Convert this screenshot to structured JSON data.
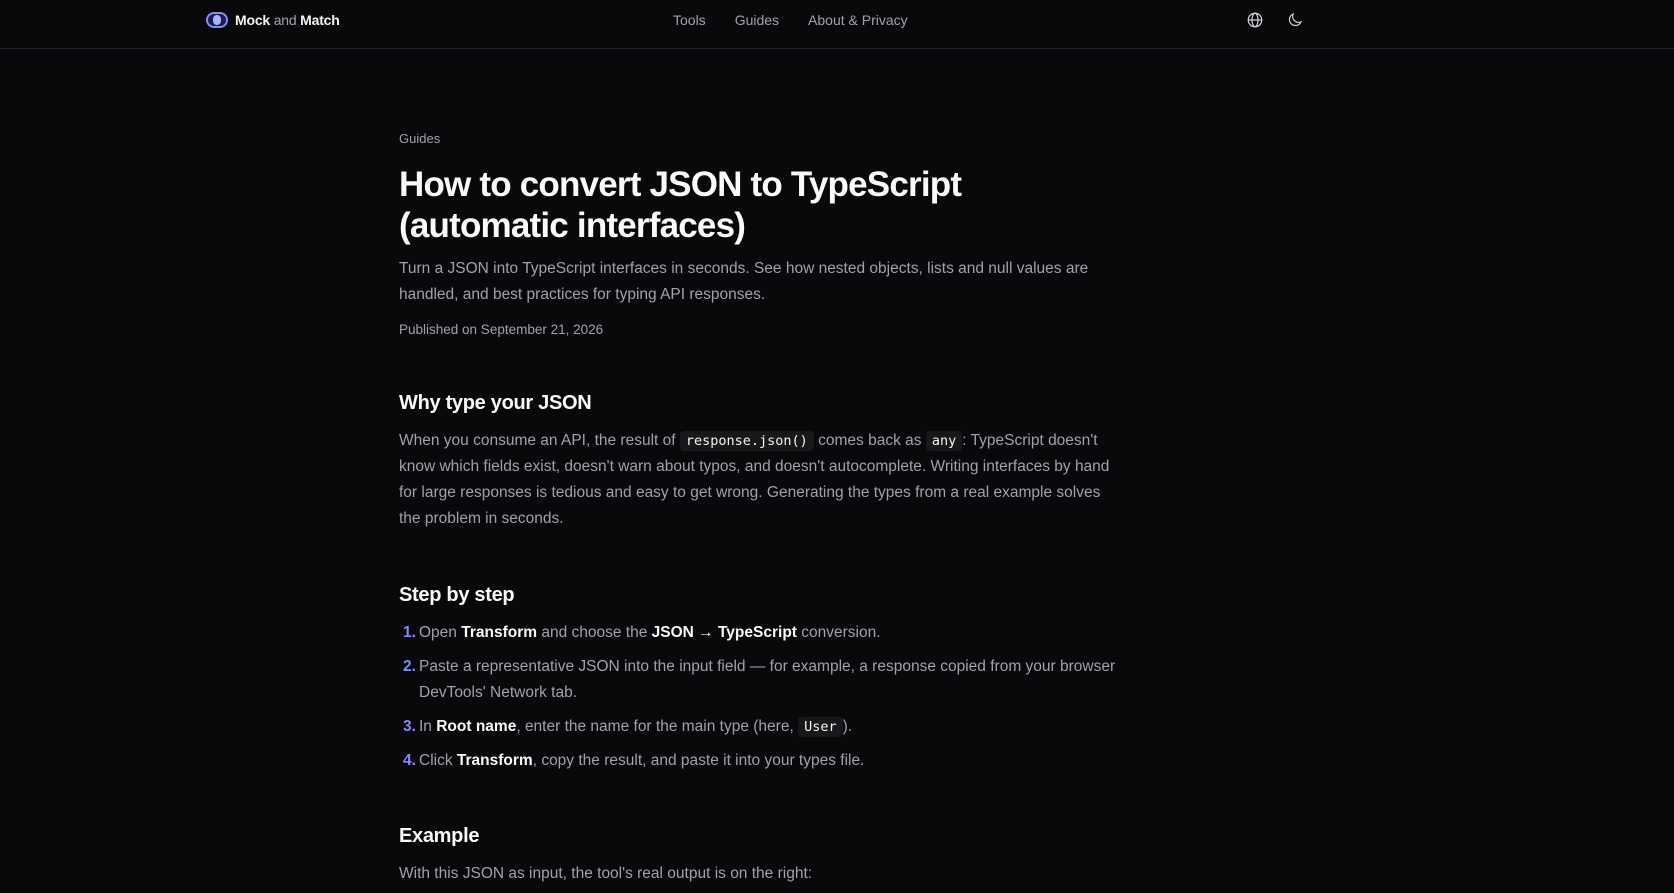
{
  "header": {
    "brand": {
      "part1": "Mock",
      "part2": "and",
      "part3": "Match"
    },
    "nav": [
      "Tools",
      "Guides",
      "About & Privacy"
    ],
    "icons": {
      "language": "globe-icon",
      "theme": "moon-icon"
    }
  },
  "article": {
    "eyebrow": "Guides",
    "title": "How to convert JSON to TypeScript (automatic interfaces)",
    "lead": "Turn a JSON into TypeScript interfaces in seconds. See how nested objects, lists and null values are handled, and best practices for typing API responses.",
    "published": "Published on September 21, 2026",
    "why": {
      "heading": "Why type your JSON",
      "t1": "When you consume an API, the result of ",
      "code1": "response.json()",
      "t2": " comes back as ",
      "code2": "any",
      "t3": ": TypeScript doesn't know which fields exist, doesn't warn about typos, and doesn't autocomplete. Writing interfaces by hand for large responses is tedious and easy to get wrong. Generating the types from a real example solves the problem in seconds."
    },
    "steps": {
      "heading": "Step by step",
      "items": [
        {
          "num": "1.",
          "a": "Open ",
          "b": "Transform",
          "c": " and choose the ",
          "d": "JSON → TypeScript",
          "e": " conversion."
        },
        {
          "num": "2.",
          "text": "Paste a representative JSON into the input field — for example, a response copied from your browser DevTools' Network tab."
        },
        {
          "num": "3.",
          "a": "In ",
          "b": "Root name",
          "c": ", enter the name for the main type (here, ",
          "code": "User",
          "e": ")."
        },
        {
          "num": "4.",
          "a": "Click ",
          "b": "Transform",
          "c": ", copy the result, and paste it into your types file."
        }
      ]
    },
    "example": {
      "heading": "Example",
      "text": "With this JSON as input, the tool's real output is on the right:"
    }
  },
  "colors": {
    "background": "#09090b",
    "accent": "#818cf8",
    "heading": "#fafafa",
    "text": "#a1a1aa"
  }
}
